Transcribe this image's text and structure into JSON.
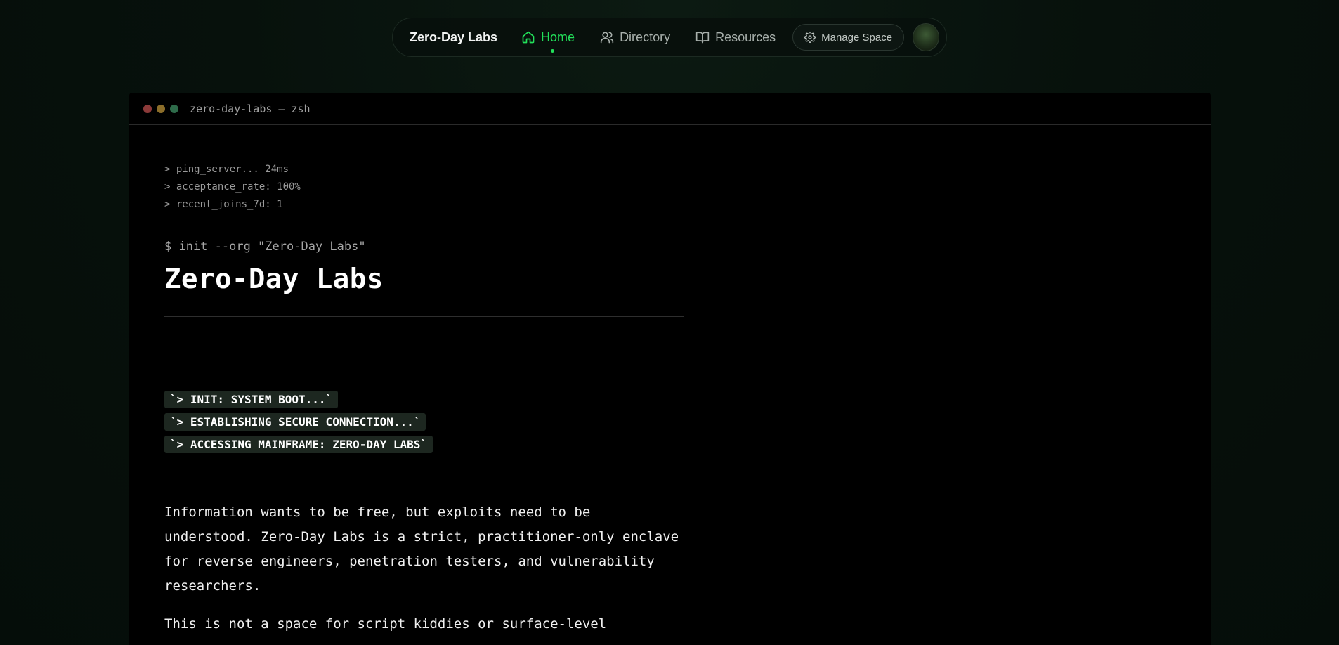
{
  "nav": {
    "brand": "Zero-Day Labs",
    "links": [
      {
        "label": "Home",
        "icon": "home-icon"
      },
      {
        "label": "Directory",
        "icon": "users-icon"
      },
      {
        "label": "Resources",
        "icon": "book-icon"
      }
    ],
    "manage_label": "Manage Space",
    "accent": "#22e05a"
  },
  "terminal": {
    "title": "zero-day-labs — zsh",
    "stats": [
      "> ping_server... 24ms",
      "> acceptance_rate: 100%",
      "> recent_joins_7d: 1"
    ],
    "command": "$ init --org \"Zero-Day Labs\"",
    "heading": "Zero-Day Labs",
    "badges": [
      "`> INIT: SYSTEM BOOT...`",
      "`> ESTABLISHING SECURE CONNECTION...`",
      "`> ACCESSING MAINFRAME: ZERO-DAY LABS`"
    ],
    "paragraph1": "Information wants to be free, but exploits need to be understood. Zero-Day Labs is a strict, practitioner-only enclave for reverse engineers, penetration testers, and vulnerability researchers.",
    "paragraph2": "This is not a space for script kiddies or surface-level"
  }
}
